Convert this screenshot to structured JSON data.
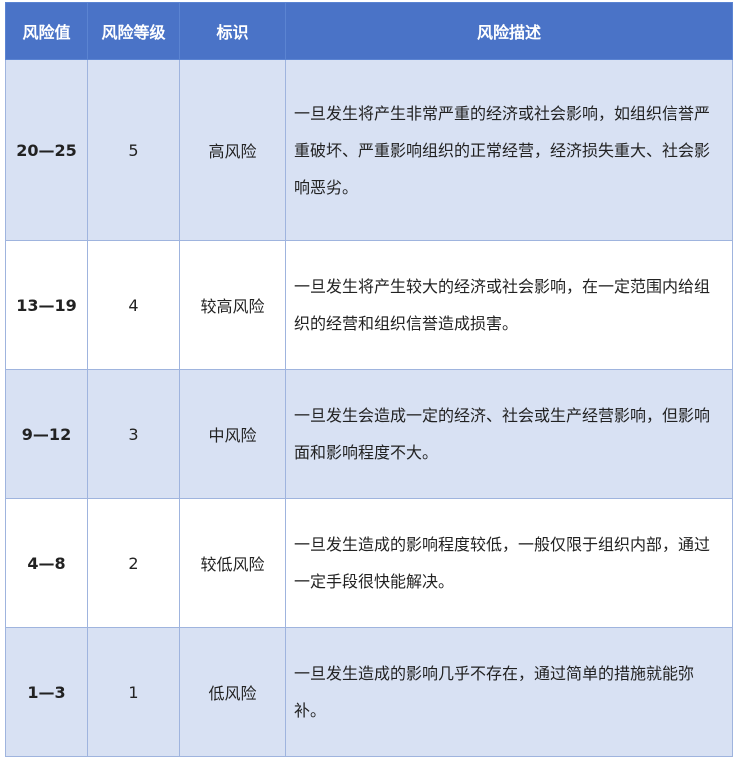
{
  "headers": [
    "风险值",
    "风险等级",
    "标识",
    "风险描述"
  ],
  "rows": [
    {
      "value": "20—25",
      "level": "5",
      "label": "高风险",
      "description": "一旦发生将产生非常严重的经济或社会影响，如组织信誉严重破坏、严重影响组织的正常经营，经济损失重大、社会影响恶劣。"
    },
    {
      "value": "13—19",
      "level": "4",
      "label": "较高风险",
      "description": "一旦发生将产生较大的经济或社会影响，在一定范围内给组织的经营和组织信誉造成损害。"
    },
    {
      "value": "9—12",
      "level": "3",
      "label": "中风险",
      "description": "一旦发生会造成一定的经济、社会或生产经营影响，但影响面和影响程度不大。"
    },
    {
      "value": "4—8",
      "level": "2",
      "label": "较低风险",
      "description": "一旦发生造成的影响程度较低，一般仅限于组织内部，通过一定手段很快能解决。"
    },
    {
      "value": "1—3",
      "level": "1",
      "label": "低风险",
      "description": "一旦发生造成的影响几乎不存在，通过简单的措施就能弥补。"
    }
  ]
}
